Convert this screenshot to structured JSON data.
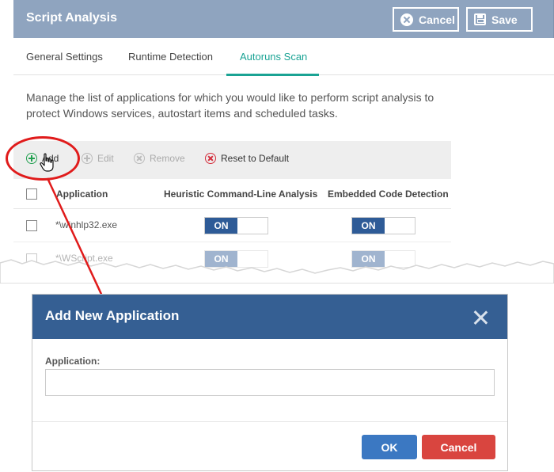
{
  "panel": {
    "title": "Script Analysis",
    "cancel_label": "Cancel",
    "save_label": "Save"
  },
  "tabs": [
    {
      "label": "General Settings"
    },
    {
      "label": "Runtime Detection"
    },
    {
      "label": "Autoruns Scan",
      "active": true
    }
  ],
  "description": "Manage the list of applications for which you would like to perform script analysis to protect Windows services, autostart items and scheduled tasks.",
  "toolbar": {
    "add": "Add",
    "edit": "Edit",
    "remove": "Remove",
    "reset": "Reset to Default"
  },
  "table": {
    "columns": [
      "Application",
      "Heuristic Command-Line Analysis",
      "Embedded Code Detection"
    ],
    "rows": [
      {
        "application": "*\\winhlp32.exe",
        "heuristic": "ON",
        "embedded": "ON"
      },
      {
        "application": "*\\WScript.exe",
        "heuristic": "ON",
        "embedded": "ON"
      }
    ]
  },
  "dialog": {
    "title": "Add New Application",
    "field_label": "Application:",
    "field_value": "",
    "ok_label": "OK",
    "cancel_label": "Cancel"
  },
  "colors": {
    "panel_header": "#8fa4bf",
    "dialog_header": "#355f93",
    "accent_tab": "#1aa394",
    "toggle_on": "#2e5b97",
    "annotation": "#e01b1b",
    "ok_button": "#3b78c2",
    "cancel_button": "#d9453f"
  }
}
